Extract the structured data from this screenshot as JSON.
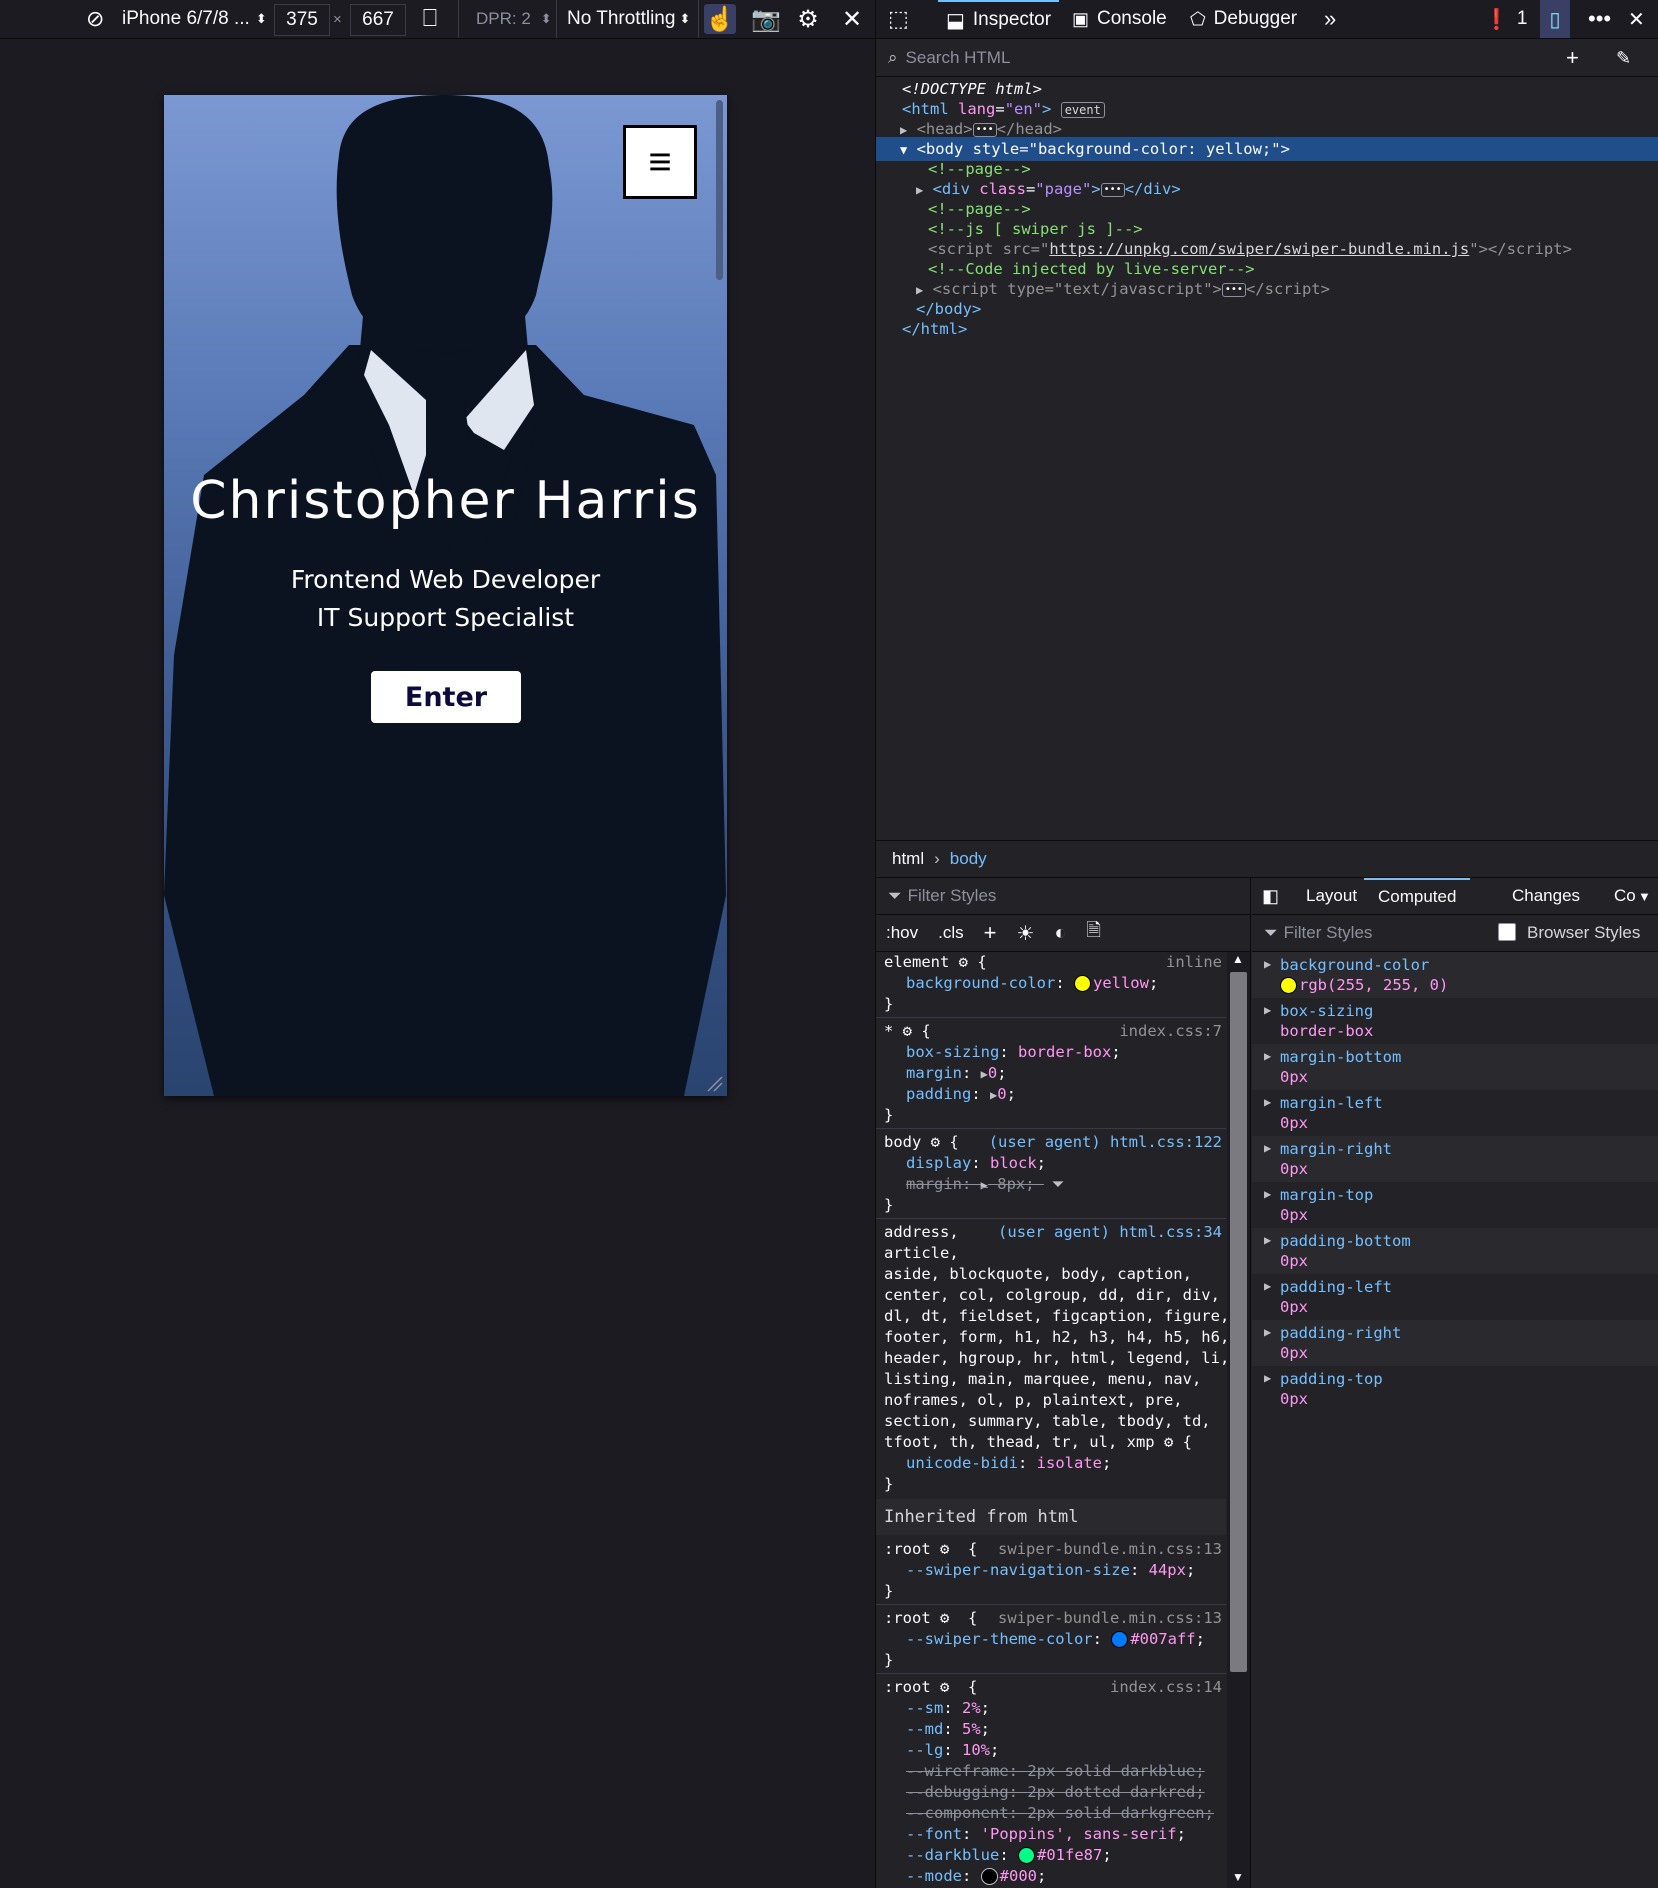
{
  "rdm_toolbar": {
    "device": "iPhone 6/7/8 ...",
    "width": "375",
    "times": "×",
    "height": "667",
    "dpr": "DPR: 2",
    "throttling": "No Throttling"
  },
  "viewport_page": {
    "menu_glyph": "≡",
    "name": "Christopher Harris",
    "subtitle_1": "Frontend Web Developer",
    "subtitle_2": "IT Support Specialist",
    "enter_label": "Enter",
    "body_color": "#ffff00"
  },
  "devtools_tabs": {
    "inspector": "Inspector",
    "console": "Console",
    "debugger": "Debugger",
    "error_count": "1"
  },
  "search_html": {
    "placeholder": "Search HTML"
  },
  "markup": {
    "doctype": "<!DOCTYPE html>",
    "html_open_tag": "html",
    "html_lang_attr": "lang",
    "html_lang_val": "\"en\"",
    "event_badge": "event",
    "head": "head",
    "body_tag": "body",
    "body_style_attr": "style",
    "body_style_val": "\"background-color: yellow;\"",
    "comment_page": "<!--page-->",
    "div_tag": "div",
    "div_class_attr": "class",
    "div_class_val": "\"page\"",
    "comment_js": "<!--js [ swiper js ]-->",
    "script_src_attr": "src",
    "script_src_val": "https://unpkg.com/swiper/swiper-bundle.min.js",
    "comment_live": "<!--Code injected by live-server-->",
    "script_type_attr": "type",
    "script_type_val": "\"text/javascript\"",
    "body_close": "</body>",
    "html_close": "</html>"
  },
  "breadcrumbs": [
    "html",
    "body"
  ],
  "rules": {
    "filter_placeholder": "Filter Styles",
    "hov": ":hov",
    "cls": ".cls",
    "element_selector": "element",
    "element_src": "inline",
    "element_prop": "background-color",
    "element_val": "yellow",
    "star_src": "index.css:7",
    "star_props": [
      {
        "name": "box-sizing",
        "value": "border-box"
      },
      {
        "name": "margin",
        "value": "0"
      },
      {
        "name": "padding",
        "value": "0"
      }
    ],
    "body_selector": "body",
    "body_src": "(user agent) html.css:122",
    "body_display": {
      "name": "display",
      "value": "block"
    },
    "body_margin": {
      "name": "margin",
      "value": "8px"
    },
    "address_src": "(user agent) html.css:34",
    "address_selector_lines": [
      "address,",
      "article,",
      "aside, blockquote, body, caption,",
      "center, col, colgroup, dd, dir, div,",
      "dl, dt, fieldset, figcaption, figure,",
      "footer, form, h1, h2, h3, h4, h5, h6,",
      "header, hgroup, hr, html, legend, li,",
      "listing, main, marquee, menu, nav,",
      "noframes, ol, p, plaintext, pre,",
      "section, summary, table, tbody, td,",
      "tfoot, th, thead, tr, ul, xmp"
    ],
    "address_prop": {
      "name": "unicode-bidi",
      "value": "isolate"
    },
    "inherited_label": "Inherited from html",
    "root_selector": ":root",
    "root1_src": "swiper-bundle.min.css:13",
    "root1_prop": {
      "name": "--swiper-navigation-size",
      "value": "44px"
    },
    "root2_src": "swiper-bundle.min.css:13",
    "root2_prop": {
      "name": "--swiper-theme-color",
      "value": "#007aff",
      "color": "#007aff"
    },
    "root3_src": "index.css:14",
    "root3_props": [
      {
        "name": "--sm",
        "value": "2%"
      },
      {
        "name": "--md",
        "value": "5%"
      },
      {
        "name": "--lg",
        "value": "10%"
      }
    ],
    "root3_struck": [
      {
        "name": "--wireframe",
        "value": "2px solid darkblue"
      },
      {
        "name": "--debugging",
        "value": "2px dotted darkred"
      },
      {
        "name": "--component",
        "value": "2px solid darkgreen"
      }
    ],
    "root3_font": {
      "name": "--font",
      "value": "'Poppins', sans-serif"
    },
    "root3_darkblue": {
      "name": "--darkblue",
      "value": "#01fe87",
      "color": "#01fe87"
    },
    "root3_mode": {
      "name": "--mode",
      "value": "#000",
      "color": "#000000"
    }
  },
  "side_tabs": {
    "layout": "Layout",
    "computed": "Computed",
    "changes": "Changes",
    "more": "Co"
  },
  "computed": {
    "filter_placeholder": "Filter Styles",
    "browser_styles": "Browser Styles",
    "props": [
      {
        "name": "background-color",
        "value": "rgb(255, 255, 0)"
      },
      {
        "name": "box-sizing",
        "value": "border-box"
      },
      {
        "name": "margin-bottom",
        "value": "0px"
      },
      {
        "name": "margin-left",
        "value": "0px"
      },
      {
        "name": "margin-right",
        "value": "0px"
      },
      {
        "name": "margin-top",
        "value": "0px"
      },
      {
        "name": "padding-bottom",
        "value": "0px"
      },
      {
        "name": "padding-left",
        "value": "0px"
      },
      {
        "name": "padding-right",
        "value": "0px"
      },
      {
        "name": "padding-top",
        "value": "0px"
      }
    ]
  }
}
